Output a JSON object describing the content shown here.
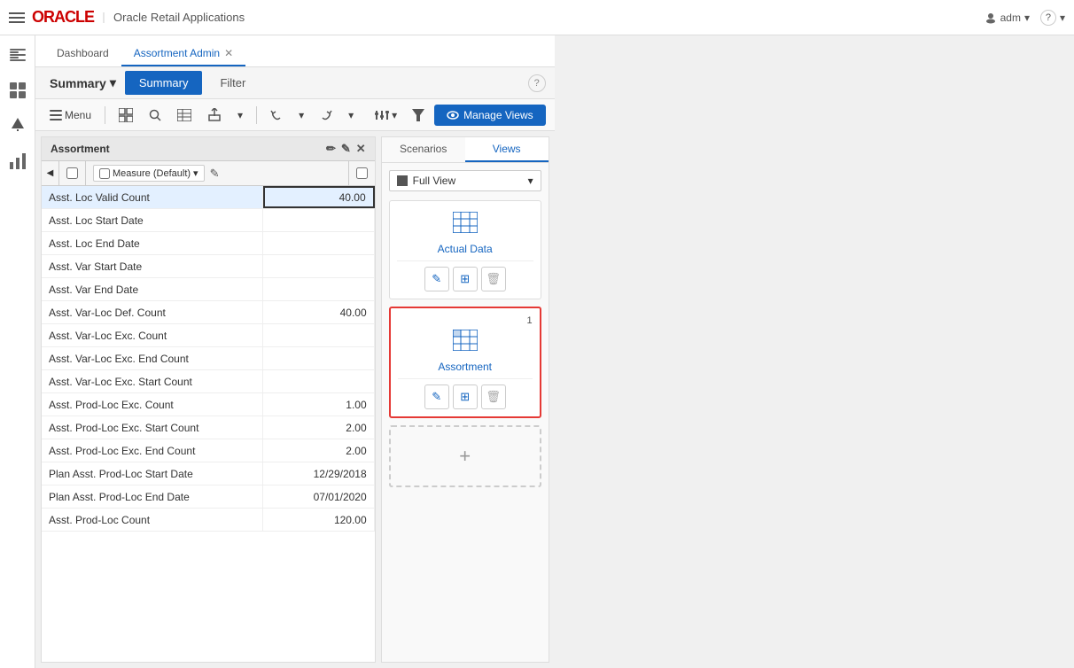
{
  "topbar": {
    "oracle_logo": "ORACLE",
    "app_title": "Oracle Retail Applications",
    "user": "adm",
    "help_label": "?"
  },
  "sidebar": {
    "icons": [
      "menu",
      "dashboard",
      "alert",
      "chart"
    ]
  },
  "tabs": {
    "items": [
      {
        "label": "Dashboard",
        "active": false,
        "closeable": false
      },
      {
        "label": "Assortment Admin",
        "active": true,
        "closeable": true
      }
    ]
  },
  "sub_tabs": {
    "summary_dropdown_label": "Summary",
    "tabs": [
      {
        "label": "Summary",
        "active": true
      },
      {
        "label": "Filter",
        "active": false
      }
    ]
  },
  "toolbar": {
    "menu_label": "Menu",
    "undo_label": "↩",
    "redo_label": "↪",
    "manage_views_label": "Manage Views"
  },
  "assortment_panel": {
    "title": "Assortment",
    "measure_dropdown": "Measure (Default)",
    "column_header": "",
    "rows": [
      {
        "label": "Asst. Loc Valid Count",
        "value": "40.00",
        "highlighted": true
      },
      {
        "label": "Asst. Loc Start Date",
        "value": ""
      },
      {
        "label": "Asst. Loc End Date",
        "value": ""
      },
      {
        "label": "Asst. Var Start Date",
        "value": ""
      },
      {
        "label": "Asst. Var End Date",
        "value": ""
      },
      {
        "label": "Asst. Var-Loc Def. Count",
        "value": "40.00"
      },
      {
        "label": "Asst. Var-Loc Exc. Count",
        "value": ""
      },
      {
        "label": "Asst. Var-Loc Exc. End Count",
        "value": ""
      },
      {
        "label": "Asst. Var-Loc Exc. Start Count",
        "value": ""
      },
      {
        "label": "Asst. Prod-Loc Exc. Count",
        "value": "1.00"
      },
      {
        "label": "Asst. Prod-Loc Exc. Start Count",
        "value": "2.00"
      },
      {
        "label": "Asst. Prod-Loc Exc. End Count",
        "value": "2.00"
      },
      {
        "label": "Plan Asst. Prod-Loc Start Date",
        "value": "12/29/2018"
      },
      {
        "label": "Plan Asst. Prod-Loc End Date",
        "value": "07/01/2020"
      },
      {
        "label": "Asst. Prod-Loc Count",
        "value": "120.00"
      }
    ]
  },
  "right_panel": {
    "tabs": [
      {
        "label": "Scenarios",
        "active": false
      },
      {
        "label": "Views",
        "active": true
      }
    ],
    "full_view_label": "Full View",
    "views": [
      {
        "id": "actual-data",
        "label": "Actual Data",
        "number": null,
        "highlighted": false
      },
      {
        "id": "assortment",
        "label": "Assortment",
        "number": "1",
        "highlighted": true
      }
    ],
    "add_label": "+"
  }
}
